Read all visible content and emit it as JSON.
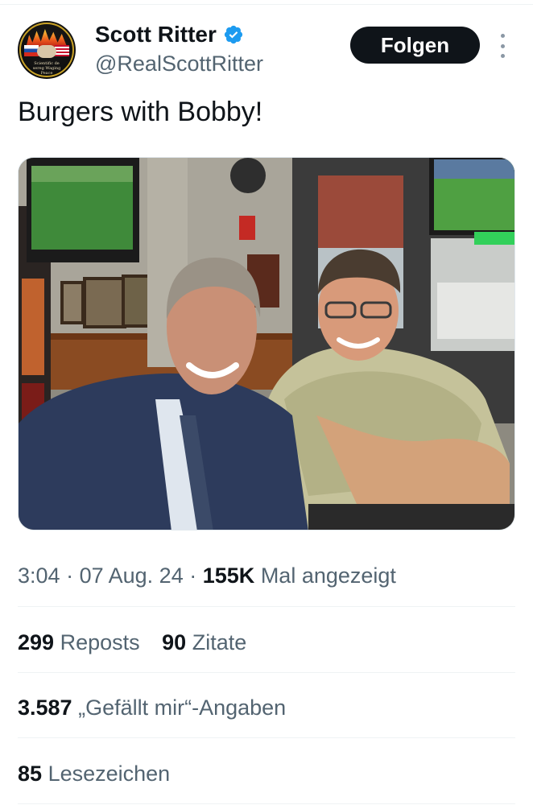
{
  "tweet": {
    "author": {
      "display_name": "Scott Ritter",
      "handle": "@RealScottRitter",
      "verified": true,
      "avatar_caption": "Scientific de sereg Waging Peace"
    },
    "follow_label": "Folgen",
    "text": "Burgers with Bobby!",
    "meta": {
      "time": "3:04",
      "sep1": "·",
      "date": "07 Aug. 24",
      "sep2": "·",
      "views_count": "155K",
      "views_label": "Mal angezeigt"
    },
    "stats": {
      "reposts_count": "299",
      "reposts_label": "Reposts",
      "quotes_count": "90",
      "quotes_label": "Zitate",
      "likes_count": "3.587",
      "likes_label": "„Gefällt mir“-Angaben",
      "bookmarks_count": "85",
      "bookmarks_label": "Lesezeichen"
    }
  },
  "colors": {
    "text_primary": "#0f1419",
    "text_secondary": "#536471",
    "verified_blue": "#1d9bf0",
    "follow_button_bg": "#0f1419",
    "divider": "#eff3f4"
  },
  "icons": {
    "verified": "verified-badge-icon",
    "more": "more-vertical-icon"
  }
}
